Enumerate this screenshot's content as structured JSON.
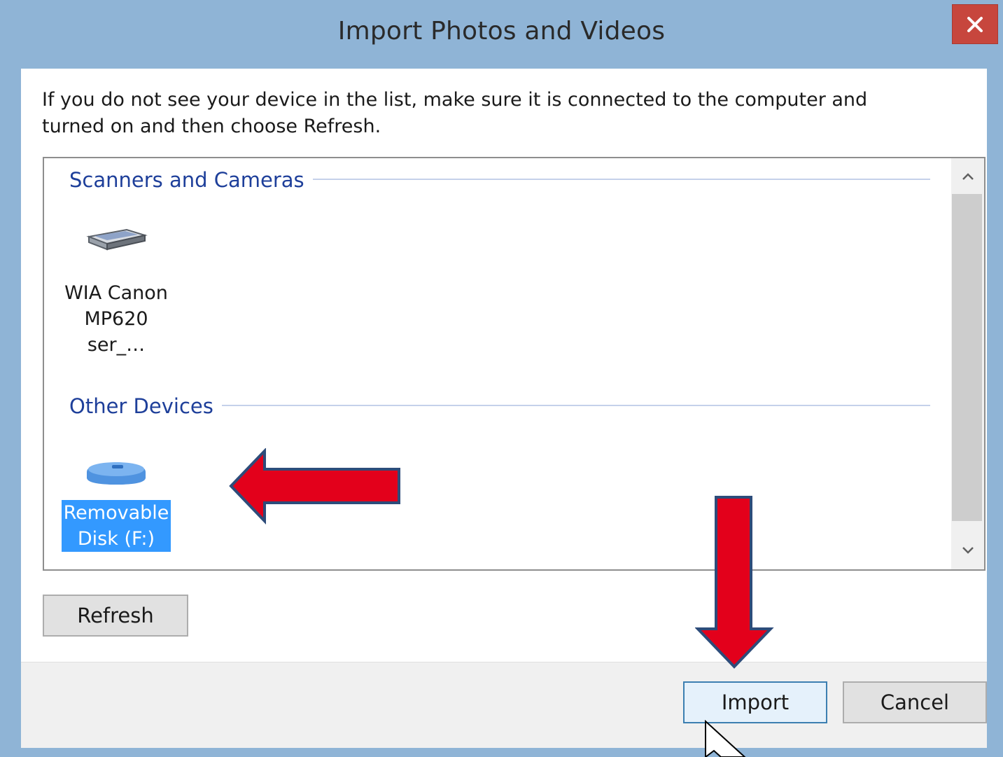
{
  "window": {
    "title": "Import Photos and Videos",
    "close_glyph": "✕"
  },
  "instructions": "If you do not see your device in the list, make sure it is connected to the computer and turned on and then choose Refresh.",
  "device_list": {
    "groups": [
      {
        "header": "Scanners and Cameras",
        "devices": [
          {
            "label_line1": "WIA Canon",
            "label_line2": "MP620 ser_…",
            "icon": "scanner-icon",
            "selected": false
          }
        ]
      },
      {
        "header": "Other Devices",
        "devices": [
          {
            "label_line1": "Removable",
            "label_line2": "Disk (F:)",
            "icon": "removable-disk-icon",
            "selected": true
          }
        ]
      }
    ]
  },
  "buttons": {
    "refresh": "Refresh",
    "import": "Import",
    "cancel": "Cancel"
  },
  "colors": {
    "title_bar": "#8fb4d6",
    "close_button": "#c7463d",
    "group_header": "#1e3f9a",
    "selection": "#3399ff",
    "annotation_arrow": "#e3001b"
  }
}
